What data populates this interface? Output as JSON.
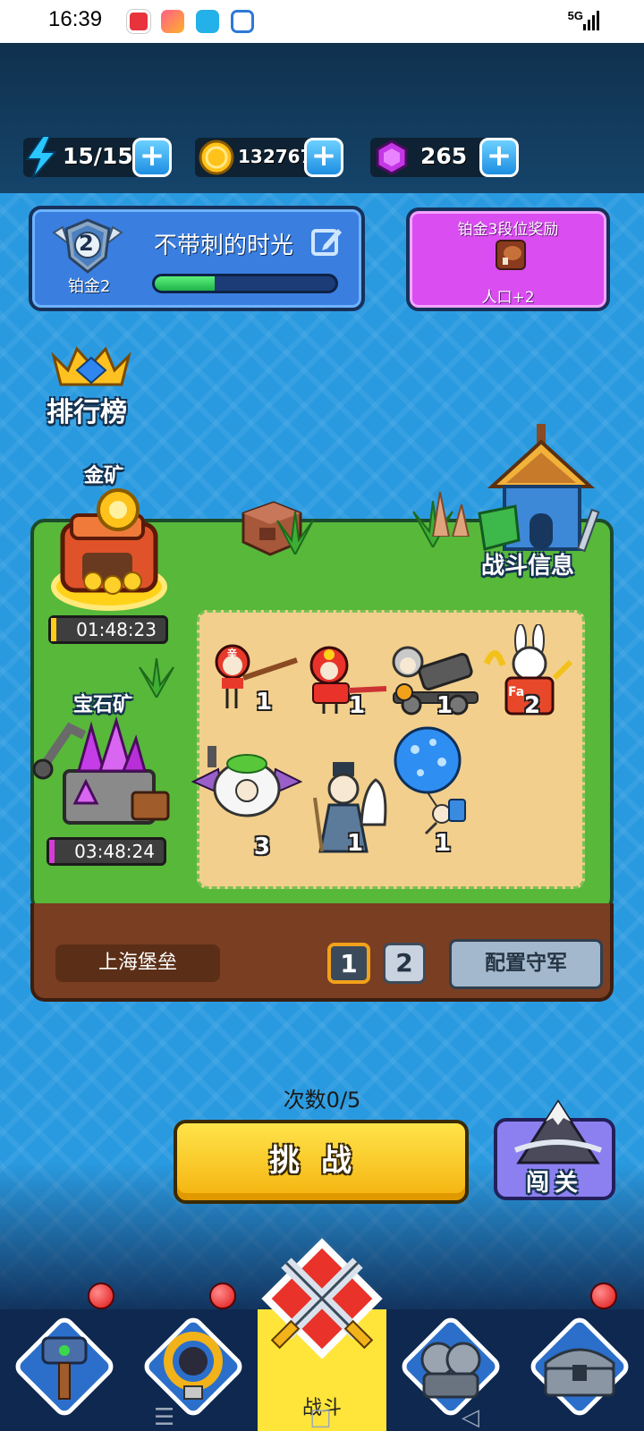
{
  "status_bar": {
    "time": "16:39",
    "network": "5G",
    "app_icons": [
      "video-app-icon",
      "play-app-icon",
      "shield-app-icon",
      "bell-app-icon"
    ]
  },
  "resources": {
    "energy": {
      "value": "15/15",
      "icon": "lightning-icon"
    },
    "gold": {
      "value": "132767",
      "icon": "gold-coin-icon"
    },
    "gems": {
      "value": "265",
      "icon": "purple-gem-icon"
    }
  },
  "player": {
    "name": "不带刺的时光",
    "rank_number": "2",
    "rank_label": "铂金2",
    "progress": 0.33
  },
  "reward": {
    "title": "铂金3段位奖励",
    "icon": "meat-icon",
    "text": "人口+2"
  },
  "leaderboard": {
    "label": "排行榜"
  },
  "battle_info": {
    "label": "战斗信息"
  },
  "mines": {
    "gold": {
      "label": "金矿",
      "timer": "01:48:23",
      "progress": 0.05,
      "color": "#ffcc1a"
    },
    "gem": {
      "label": "宝石矿",
      "timer": "03:48:24",
      "progress": 0.05,
      "color": "#d63bd6"
    }
  },
  "units": [
    {
      "count": "1",
      "icon": "red-samurai-unit-icon"
    },
    {
      "count": "1",
      "icon": "red-helmet-gunner-unit-icon"
    },
    {
      "count": "1",
      "icon": "cannon-unit-icon"
    },
    {
      "count": "2",
      "icon": "rabbit-king-unit-icon"
    },
    {
      "count": "3",
      "icon": "flying-sheep-unit-icon"
    },
    {
      "count": "1",
      "icon": "monk-unit-icon"
    },
    {
      "count": "1",
      "icon": "balloon-unit-icon"
    }
  ],
  "unit_badges": {
    "samurai": "辛",
    "king": "Fa"
  },
  "fortress": {
    "name": "上海堡垒",
    "pages": [
      "1",
      "2"
    ],
    "active_page": "1",
    "configure_label": "配置守军"
  },
  "challenge": {
    "attempts": "次数0/5",
    "button": "挑战",
    "level_button": "闯关"
  },
  "nav": {
    "active_label": "战斗",
    "tabs": [
      "hammer-icon",
      "ring-icon",
      "crossed-swords-icon",
      "soldiers-icon",
      "treasure-chest-icon"
    ]
  },
  "colors": {
    "gold_mine": "#ffcc1a",
    "gem_mine": "#d63bd6",
    "challenge": "#f4b20e",
    "nav_active": "#ffe53a"
  }
}
